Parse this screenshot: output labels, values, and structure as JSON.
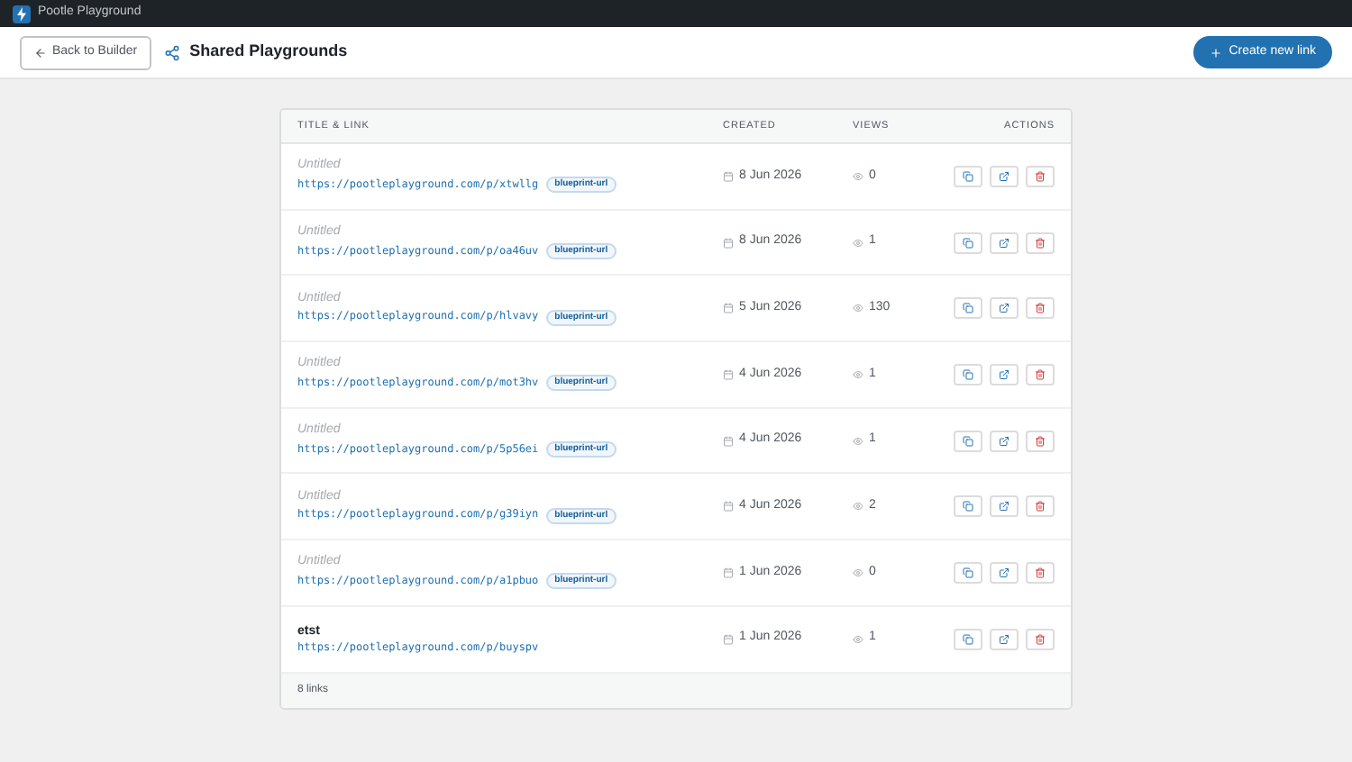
{
  "app_bar": {
    "title": "Pootle Playground"
  },
  "header": {
    "back_button": "Back to Builder",
    "title": "Shared Playgrounds",
    "create_button": "Create new link"
  },
  "table": {
    "columns": [
      "TITLE & LINK",
      "CREATED",
      "VIEWS",
      "ACTIONS"
    ],
    "rows": [
      {
        "kind": "untitled",
        "title": "Untitled",
        "url": "https://pootleplayground.com/p/xtwllg",
        "tag": "blueprint-url",
        "created": "8 Jun 2026",
        "views": "0"
      },
      {
        "kind": "untitled",
        "title": "Untitled",
        "url": "https://pootleplayground.com/p/oa46uv",
        "tag": "blueprint-url",
        "created": "8 Jun 2026",
        "views": "1"
      },
      {
        "kind": "untitled",
        "title": "Untitled",
        "url": "https://pootleplayground.com/p/hlvavy",
        "tag": "blueprint-url",
        "created": "5 Jun 2026",
        "views": "130"
      },
      {
        "kind": "untitled",
        "title": "Untitled",
        "url": "https://pootleplayground.com/p/mot3hv",
        "tag": "blueprint-url",
        "created": "4 Jun 2026",
        "views": "1"
      },
      {
        "kind": "untitled",
        "title": "Untitled",
        "url": "https://pootleplayground.com/p/5p56ei",
        "tag": "blueprint-url",
        "created": "4 Jun 2026",
        "views": "1"
      },
      {
        "kind": "untitled",
        "title": "Untitled",
        "url": "https://pootleplayground.com/p/g39iyn",
        "tag": "blueprint-url",
        "created": "4 Jun 2026",
        "views": "2"
      },
      {
        "kind": "untitled",
        "title": "Untitled",
        "url": "https://pootleplayground.com/p/a1pbuo",
        "tag": "blueprint-url",
        "created": "1 Jun 2026",
        "views": "0"
      },
      {
        "kind": "named",
        "title": "etst",
        "url": "https://pootleplayground.com/p/buyspv",
        "created": "1 Jun 2026",
        "views": "1"
      }
    ],
    "footer": "8 links"
  }
}
